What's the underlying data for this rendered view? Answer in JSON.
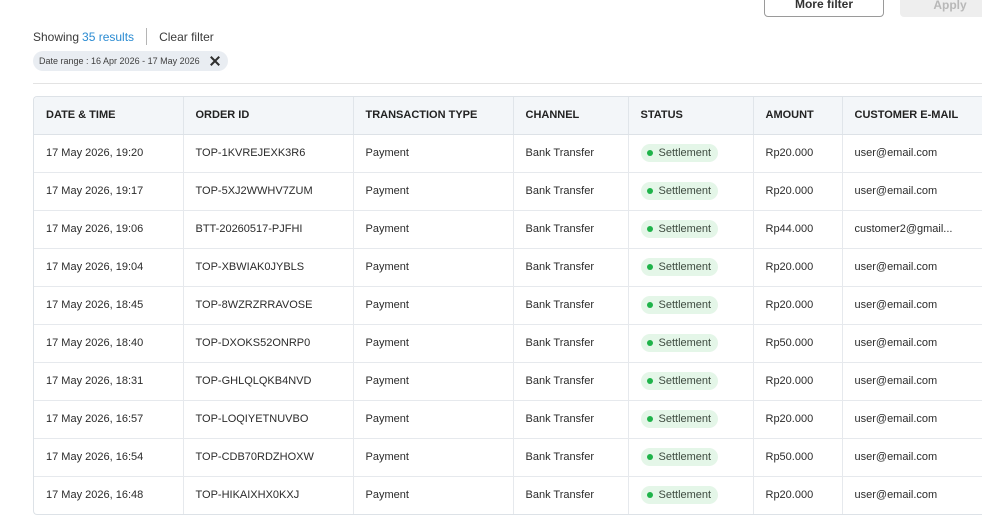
{
  "top_buttons": {
    "more_filter": "More filter",
    "apply": "Apply"
  },
  "summary": {
    "showing": "Showing",
    "count": "35 results",
    "clear": "Clear filter"
  },
  "chip": {
    "label": "Date range : 16 Apr 2026 - 17 May 2026"
  },
  "table": {
    "headers": [
      "DATE & TIME",
      "ORDER ID",
      "TRANSACTION TYPE",
      "CHANNEL",
      "STATUS",
      "AMOUNT",
      "CUSTOMER E-MAIL"
    ],
    "rows": [
      {
        "date": "17 May 2026, 19:20",
        "order_id": "TOP-1KVREJEXK3R6",
        "type": "Payment",
        "channel": "Bank Transfer",
        "status": "Settlement",
        "amount": "Rp20.000",
        "email": "user@email.com"
      },
      {
        "date": "17 May 2026, 19:17",
        "order_id": "TOP-5XJ2WWHV7ZUM",
        "type": "Payment",
        "channel": "Bank Transfer",
        "status": "Settlement",
        "amount": "Rp20.000",
        "email": "user@email.com"
      },
      {
        "date": "17 May 2026, 19:06",
        "order_id": "BTT-20260517-PJFHI",
        "type": "Payment",
        "channel": "Bank Transfer",
        "status": "Settlement",
        "amount": "Rp44.000",
        "email": "customer2@gmail..."
      },
      {
        "date": "17 May 2026, 19:04",
        "order_id": "TOP-XBWIAK0JYBLS",
        "type": "Payment",
        "channel": "Bank Transfer",
        "status": "Settlement",
        "amount": "Rp20.000",
        "email": "user@email.com"
      },
      {
        "date": "17 May 2026, 18:45",
        "order_id": "TOP-8WZRZRRAVOSE",
        "type": "Payment",
        "channel": "Bank Transfer",
        "status": "Settlement",
        "amount": "Rp20.000",
        "email": "user@email.com"
      },
      {
        "date": "17 May 2026, 18:40",
        "order_id": "TOP-DXOKS52ONRP0",
        "type": "Payment",
        "channel": "Bank Transfer",
        "status": "Settlement",
        "amount": "Rp50.000",
        "email": "user@email.com"
      },
      {
        "date": "17 May 2026, 18:31",
        "order_id": "TOP-GHLQLQKB4NVD",
        "type": "Payment",
        "channel": "Bank Transfer",
        "status": "Settlement",
        "amount": "Rp20.000",
        "email": "user@email.com"
      },
      {
        "date": "17 May 2026, 16:57",
        "order_id": "TOP-LOQIYETNUVBO",
        "type": "Payment",
        "channel": "Bank Transfer",
        "status": "Settlement",
        "amount": "Rp20.000",
        "email": "user@email.com"
      },
      {
        "date": "17 May 2026, 16:54",
        "order_id": "TOP-CDB70RDZHOXW",
        "type": "Payment",
        "channel": "Bank Transfer",
        "status": "Settlement",
        "amount": "Rp50.000",
        "email": "user@email.com"
      },
      {
        "date": "17 May 2026, 16:48",
        "order_id": "TOP-HIKAIXHX0KXJ",
        "type": "Payment",
        "channel": "Bank Transfer",
        "status": "Settlement",
        "amount": "Rp20.000",
        "email": "user@email.com"
      }
    ]
  },
  "colors": {
    "link": "#2a8bd2",
    "status_dot": "#1fb34a",
    "status_bg": "#e4f6e8",
    "header_bg": "#f3f6f9"
  }
}
